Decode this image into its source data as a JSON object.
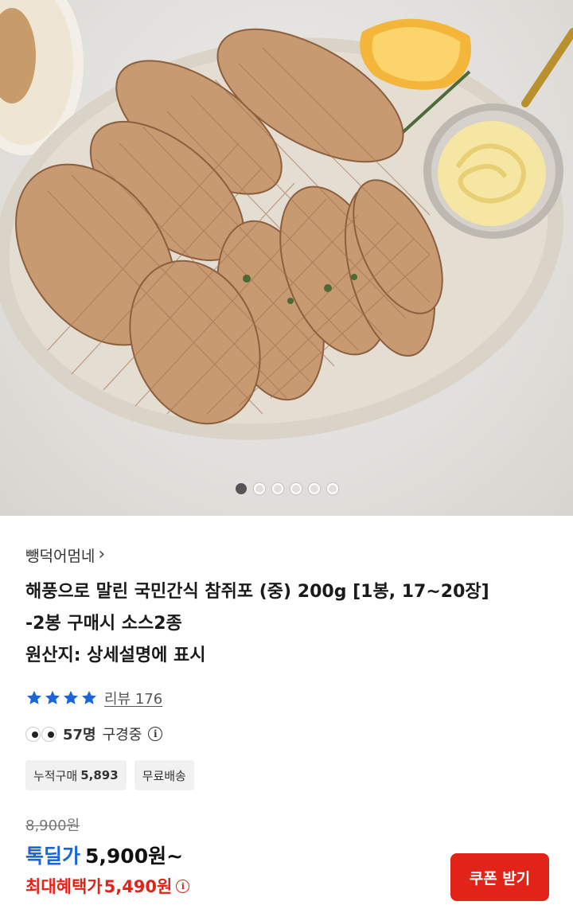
{
  "gallery": {
    "image_alt": "해풍으로 말린 참쥐포 상품 이미지",
    "slide_count": 6,
    "active_slide": 1
  },
  "store": {
    "name": "뺑덕어멈네",
    "chevron": "›"
  },
  "product": {
    "title_line1": "해풍으로 말린 국민간식 참쥐포 (중) 200g [1봉, 17~20장]",
    "title_line2": "-2봉 구매시 소스2종",
    "title_line3": "원산지: 상세설명에 표시"
  },
  "rating": {
    "stars": 4,
    "review_label": "리뷰 176",
    "star_color": "#1b64da"
  },
  "viewers": {
    "count_text": "57명",
    "suffix": "구경중",
    "info_glyph": "i"
  },
  "chips": [
    {
      "label": "누적구매",
      "value": "5,893"
    },
    {
      "label": "무료배송",
      "value": ""
    }
  ],
  "price": {
    "original": "8,900원",
    "deal_label": "톡딜가",
    "deal_price": "5,900원~",
    "max_label": "최대혜택가",
    "max_price": "5,490원",
    "info_glyph": "i"
  },
  "coupon_button": {
    "label": "쿠폰 받기"
  },
  "colors": {
    "accent_red": "#e2231a",
    "deal_blue": "#1b64da"
  }
}
